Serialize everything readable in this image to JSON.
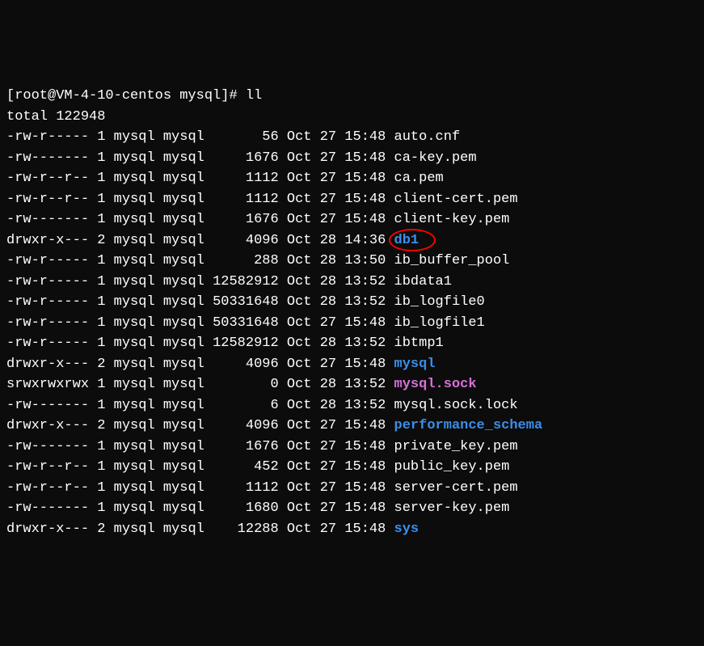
{
  "prompt": "[root@VM-4-10-centos mysql]# ll",
  "total": "total 122948",
  "rows": [
    {
      "perm": "-rw-r-----",
      "links": "1",
      "owner": "mysql",
      "group": "mysql",
      "size": "      56",
      "date": "Oct 27 15:48",
      "name": "auto.cnf",
      "color": "white",
      "circled": false
    },
    {
      "perm": "-rw-------",
      "links": "1",
      "owner": "mysql",
      "group": "mysql",
      "size": "    1676",
      "date": "Oct 27 15:48",
      "name": "ca-key.pem",
      "color": "white",
      "circled": false
    },
    {
      "perm": "-rw-r--r--",
      "links": "1",
      "owner": "mysql",
      "group": "mysql",
      "size": "    1112",
      "date": "Oct 27 15:48",
      "name": "ca.pem",
      "color": "white",
      "circled": false
    },
    {
      "perm": "-rw-r--r--",
      "links": "1",
      "owner": "mysql",
      "group": "mysql",
      "size": "    1112",
      "date": "Oct 27 15:48",
      "name": "client-cert.pem",
      "color": "white",
      "circled": false
    },
    {
      "perm": "-rw-------",
      "links": "1",
      "owner": "mysql",
      "group": "mysql",
      "size": "    1676",
      "date": "Oct 27 15:48",
      "name": "client-key.pem",
      "color": "white",
      "circled": false
    },
    {
      "perm": "drwxr-x---",
      "links": "2",
      "owner": "mysql",
      "group": "mysql",
      "size": "    4096",
      "date": "Oct 28 14:36",
      "name": "db1",
      "color": "blue",
      "circled": true
    },
    {
      "perm": "-rw-r-----",
      "links": "1",
      "owner": "mysql",
      "group": "mysql",
      "size": "     288",
      "date": "Oct 28 13:50",
      "name": "ib_buffer_pool",
      "color": "white",
      "circled": false
    },
    {
      "perm": "-rw-r-----",
      "links": "1",
      "owner": "mysql",
      "group": "mysql",
      "size": "12582912",
      "date": "Oct 28 13:52",
      "name": "ibdata1",
      "color": "white",
      "circled": false
    },
    {
      "perm": "-rw-r-----",
      "links": "1",
      "owner": "mysql",
      "group": "mysql",
      "size": "50331648",
      "date": "Oct 28 13:52",
      "name": "ib_logfile0",
      "color": "white",
      "circled": false
    },
    {
      "perm": "-rw-r-----",
      "links": "1",
      "owner": "mysql",
      "group": "mysql",
      "size": "50331648",
      "date": "Oct 27 15:48",
      "name": "ib_logfile1",
      "color": "white",
      "circled": false
    },
    {
      "perm": "-rw-r-----",
      "links": "1",
      "owner": "mysql",
      "group": "mysql",
      "size": "12582912",
      "date": "Oct 28 13:52",
      "name": "ibtmp1",
      "color": "white",
      "circled": false
    },
    {
      "perm": "drwxr-x---",
      "links": "2",
      "owner": "mysql",
      "group": "mysql",
      "size": "    4096",
      "date": "Oct 27 15:48",
      "name": "mysql",
      "color": "blue",
      "circled": false
    },
    {
      "perm": "srwxrwxrwx",
      "links": "1",
      "owner": "mysql",
      "group": "mysql",
      "size": "       0",
      "date": "Oct 28 13:52",
      "name": "mysql.sock",
      "color": "magenta",
      "circled": false
    },
    {
      "perm": "-rw-------",
      "links": "1",
      "owner": "mysql",
      "group": "mysql",
      "size": "       6",
      "date": "Oct 28 13:52",
      "name": "mysql.sock.lock",
      "color": "white",
      "circled": false
    },
    {
      "perm": "drwxr-x---",
      "links": "2",
      "owner": "mysql",
      "group": "mysql",
      "size": "    4096",
      "date": "Oct 27 15:48",
      "name": "performance_schema",
      "color": "blue",
      "circled": false
    },
    {
      "perm": "-rw-------",
      "links": "1",
      "owner": "mysql",
      "group": "mysql",
      "size": "    1676",
      "date": "Oct 27 15:48",
      "name": "private_key.pem",
      "color": "white",
      "circled": false
    },
    {
      "perm": "-rw-r--r--",
      "links": "1",
      "owner": "mysql",
      "group": "mysql",
      "size": "     452",
      "date": "Oct 27 15:48",
      "name": "public_key.pem",
      "color": "white",
      "circled": false
    },
    {
      "perm": "-rw-r--r--",
      "links": "1",
      "owner": "mysql",
      "group": "mysql",
      "size": "    1112",
      "date": "Oct 27 15:48",
      "name": "server-cert.pem",
      "color": "white",
      "circled": false
    },
    {
      "perm": "-rw-------",
      "links": "1",
      "owner": "mysql",
      "group": "mysql",
      "size": "    1680",
      "date": "Oct 27 15:48",
      "name": "server-key.pem",
      "color": "white",
      "circled": false
    },
    {
      "perm": "drwxr-x---",
      "links": "2",
      "owner": "mysql",
      "group": "mysql",
      "size": "   12288",
      "date": "Oct 27 15:48",
      "name": "sys",
      "color": "blue",
      "circled": false
    }
  ]
}
